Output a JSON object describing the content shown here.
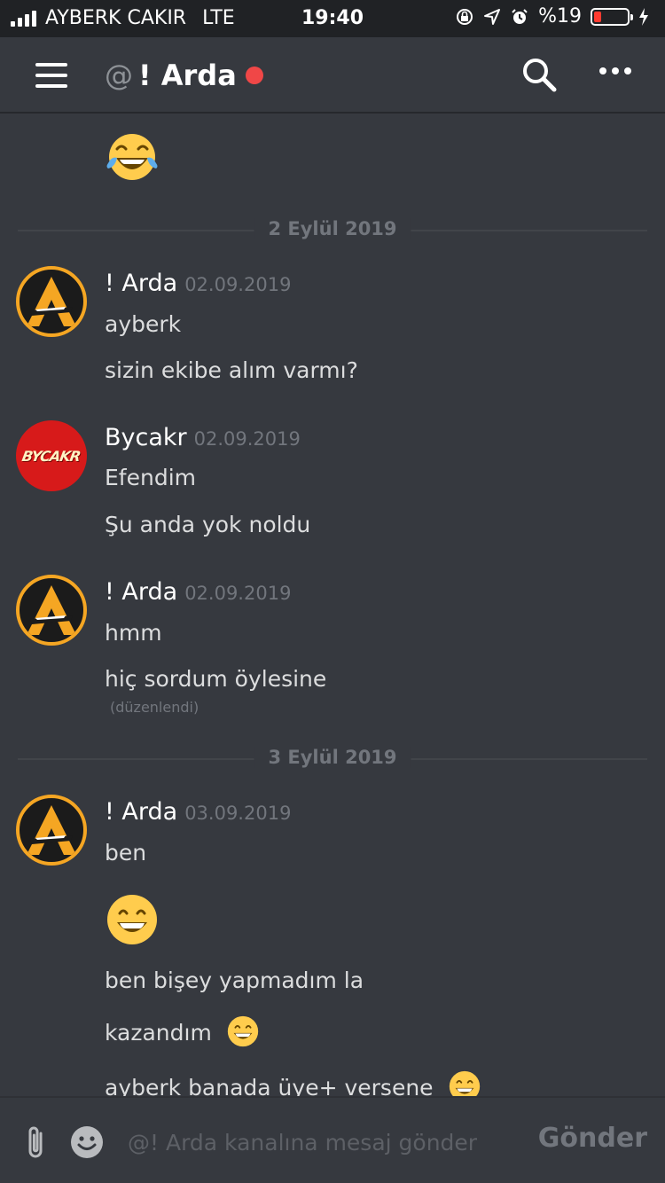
{
  "status_bar": {
    "carrier": "AYBERK CAKIR",
    "network": "LTE",
    "time": "19:40",
    "battery_text": "%19",
    "battery_level": 0.19,
    "battery_color": "#ff3b30"
  },
  "header": {
    "channel_prefix": "@",
    "channel_name": "! Arda",
    "status_color": "#f04747",
    "icons": [
      "hamburger-menu-icon",
      "search-icon",
      "more-options-icon"
    ]
  },
  "messages": {
    "dividers": [
      "2 Eylül 2019",
      "3 Eylül 2019"
    ],
    "groups": [
      {
        "author": "! Arda",
        "timestamp": "02.09.2019",
        "lines": [
          "ayberk",
          "sizin ekibe alım varmı?"
        ]
      },
      {
        "author": "Bycakr",
        "avatar_text": "BYCAKR",
        "timestamp": "02.09.2019",
        "lines": [
          "Efendim",
          "Şu anda yok noldu"
        ]
      },
      {
        "author": "! Arda",
        "timestamp": "02.09.2019",
        "lines": [
          "hmm",
          "hiç sordum öylesine"
        ],
        "edited": "(düzenlendi)"
      },
      {
        "author": "! Arda",
        "timestamp": "03.09.2019",
        "lines": [
          "ben",
          "ben bişey yapmadım la",
          "kazandım",
          "ayberk banada üye+ versene"
        ]
      }
    ]
  },
  "composer": {
    "placeholder": "@! Arda kanalına mesaj gönder",
    "send_label": "Gönder"
  },
  "colors": {
    "background": "#36393f",
    "status_bar": "#202225",
    "accent_orange": "#f5a623",
    "avatar_red": "#d71a1a"
  }
}
